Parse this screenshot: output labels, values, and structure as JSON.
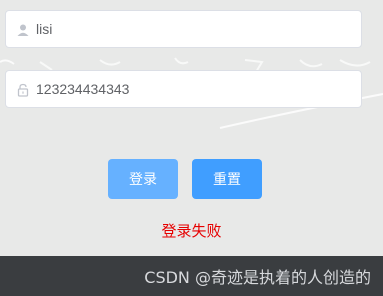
{
  "form": {
    "username": {
      "value": "lisi",
      "icon": "user-icon"
    },
    "password": {
      "value": "123234434343",
      "icon": "lock-icon"
    },
    "login_label": "登录",
    "reset_label": "重置",
    "error_text": "登录失败"
  },
  "footer": {
    "watermark": "CSDN @奇迹是执着的人创造的"
  },
  "colors": {
    "login_button": "#66b1ff",
    "reset_button": "#409eff",
    "error": "#e60000",
    "background": "#e8e9e8",
    "footer": "#3a3d40"
  }
}
